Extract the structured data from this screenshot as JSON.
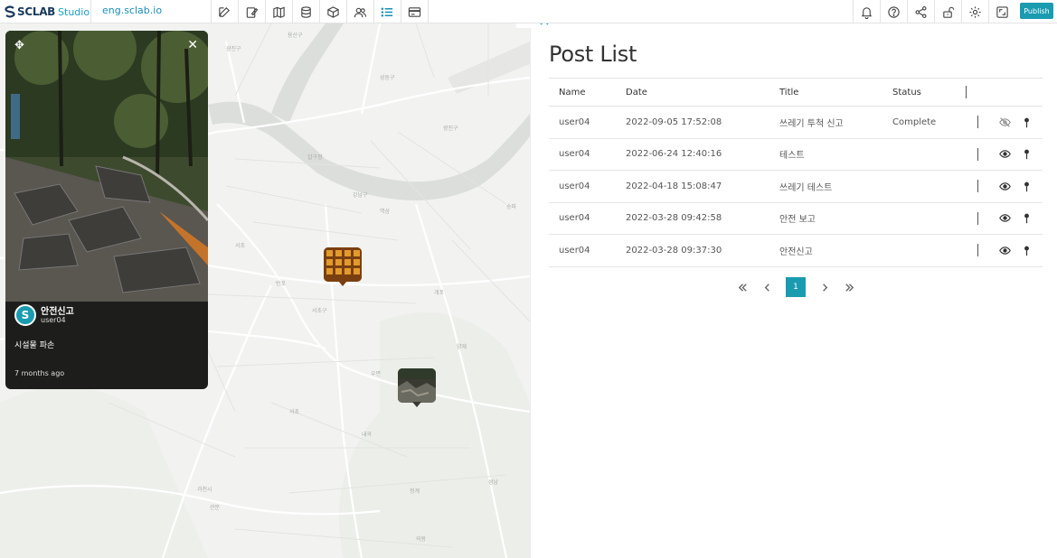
{
  "topbar": {
    "logo_text": "SCLAB",
    "logo_studio": "Studio",
    "domain": "eng.sclab.io",
    "tools": [
      {
        "icon": "edit-icon"
      },
      {
        "icon": "note-edit-icon"
      },
      {
        "icon": "map-icon"
      },
      {
        "icon": "database-icon"
      },
      {
        "icon": "cube-icon"
      },
      {
        "icon": "users-icon"
      },
      {
        "icon": "list-icon",
        "active": true
      },
      {
        "icon": "card-icon"
      }
    ],
    "right_tools": [
      "bell-icon",
      "help-icon",
      "share-icon",
      "unlock-icon",
      "settings-icon",
      "fullscreen-icon"
    ],
    "publish_label": "Publish"
  },
  "card": {
    "title": "안전신고",
    "user": "user04",
    "description": "시설물 파손",
    "time": "7 months ago",
    "avatar_letter": "S"
  },
  "panel": {
    "title": "Post List",
    "columns": [
      "Name",
      "Date",
      "Title",
      "Status"
    ],
    "rows": [
      {
        "name": "user04",
        "date": "2022-09-05 17:52:08",
        "title": "쓰레기 투척 신고",
        "status": "Complete",
        "visible": false
      },
      {
        "name": "user04",
        "date": "2022-06-24 12:40:16",
        "title": "테스트",
        "status": "",
        "visible": true
      },
      {
        "name": "user04",
        "date": "2022-04-18 15:08:47",
        "title": "쓰레기 테스트",
        "status": "",
        "visible": true
      },
      {
        "name": "user04",
        "date": "2022-03-28 09:42:58",
        "title": "안전 보고",
        "status": "",
        "visible": true
      },
      {
        "name": "user04",
        "date": "2022-03-28 09:37:30",
        "title": "안전신고",
        "status": "",
        "visible": true
      }
    ],
    "pagination": {
      "current": "1"
    }
  },
  "colors": {
    "accent": "#1a9bb0",
    "link": "#1a8fb8"
  }
}
